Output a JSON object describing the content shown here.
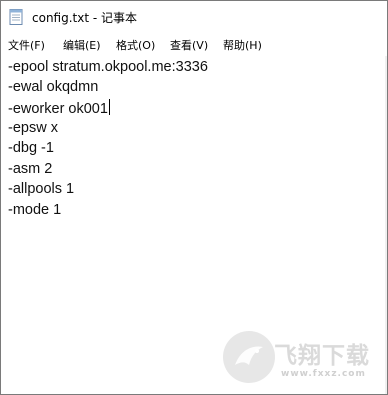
{
  "window": {
    "title": "config.txt - 记事本"
  },
  "menu": [
    {
      "label": "文件(F)"
    },
    {
      "label": "编辑(E)"
    },
    {
      "label": "格式(O)"
    },
    {
      "label": "查看(V)"
    },
    {
      "label": "帮助(H)"
    }
  ],
  "editor": {
    "lines": [
      "-epool stratum.okpool.me:3336",
      "-ewal okqdmn",
      "-eworker ok001",
      "-epsw x",
      "-dbg -1",
      "-asm 2",
      "-allpools 1",
      "-mode 1"
    ],
    "caret_line": 2
  },
  "watermark": {
    "text": "飞翔下载",
    "url": "www.fxxz.com",
    "icon": "flying-bird-logo"
  },
  "colors": {
    "window_border": "#7a7a7a",
    "text": "#111111",
    "watermark": "#dadada"
  }
}
